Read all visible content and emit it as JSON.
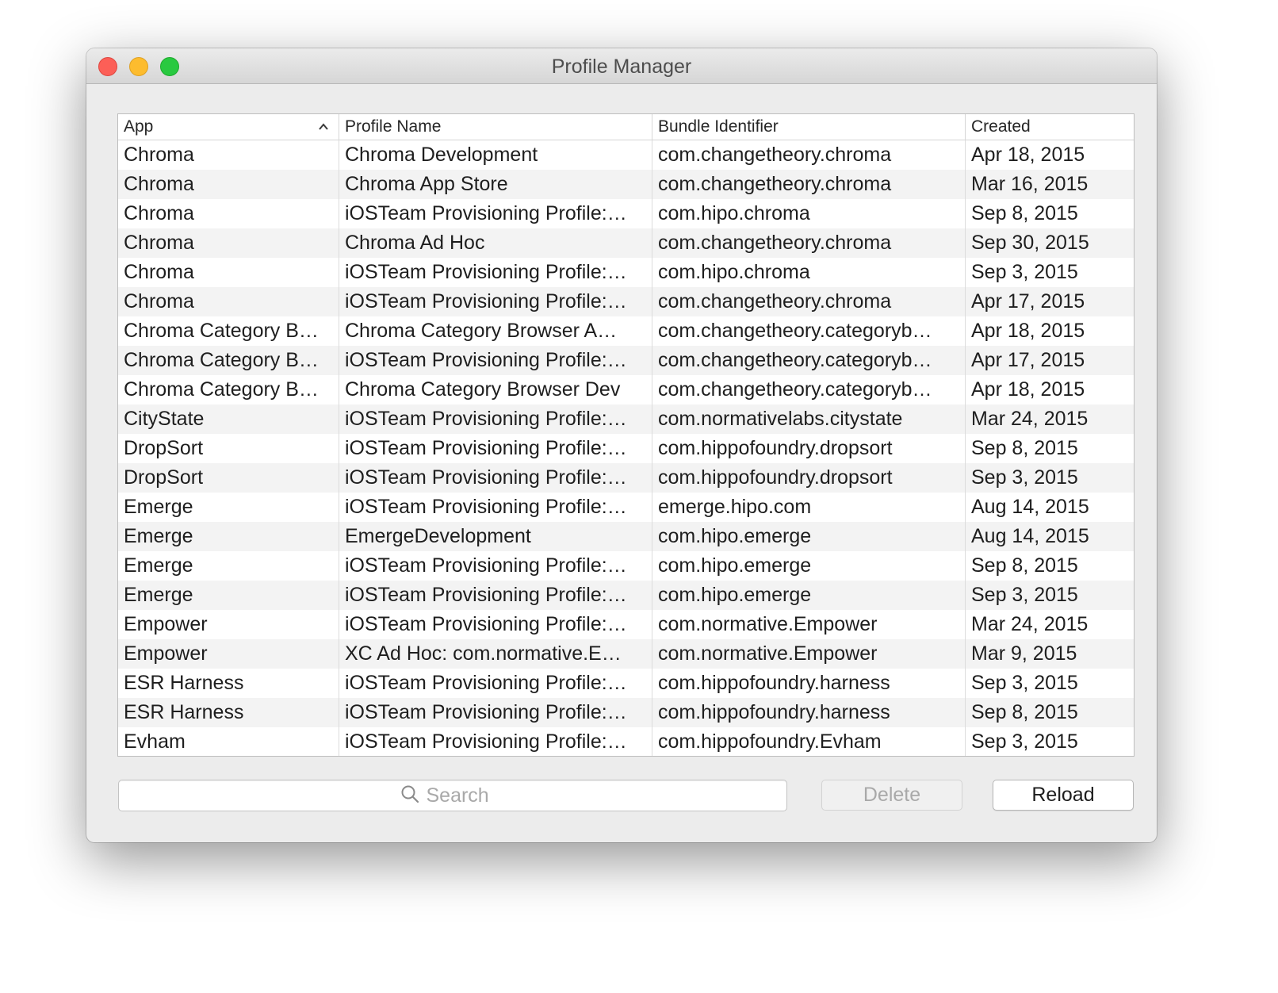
{
  "window": {
    "title": "Profile Manager"
  },
  "table": {
    "columns": {
      "app": "App",
      "profile_name": "Profile Name",
      "bundle_identifier": "Bundle Identifier",
      "created": "Created"
    },
    "sort": {
      "column": "App",
      "direction": "ascending"
    },
    "rows": [
      {
        "app": "Chroma",
        "profile": "Chroma Development",
        "bundle": "com.changetheory.chroma",
        "created": "Apr 18, 2015"
      },
      {
        "app": "Chroma",
        "profile": "Chroma App Store",
        "bundle": "com.changetheory.chroma",
        "created": "Mar 16, 2015"
      },
      {
        "app": "Chroma",
        "profile": "iOSTeam Provisioning Profile:…",
        "bundle": "com.hipo.chroma",
        "created": "Sep 8, 2015"
      },
      {
        "app": "Chroma",
        "profile": "Chroma Ad Hoc",
        "bundle": "com.changetheory.chroma",
        "created": "Sep 30, 2015"
      },
      {
        "app": "Chroma",
        "profile": "iOSTeam Provisioning Profile:…",
        "bundle": "com.hipo.chroma",
        "created": "Sep 3, 2015"
      },
      {
        "app": "Chroma",
        "profile": "iOSTeam Provisioning Profile:…",
        "bundle": "com.changetheory.chroma",
        "created": "Apr 17, 2015"
      },
      {
        "app": "Chroma Category B…",
        "profile": "Chroma Category Browser A…",
        "bundle": "com.changetheory.categoryb…",
        "created": "Apr 18, 2015"
      },
      {
        "app": "Chroma Category B…",
        "profile": "iOSTeam Provisioning Profile:…",
        "bundle": "com.changetheory.categoryb…",
        "created": "Apr 17, 2015"
      },
      {
        "app": "Chroma Category B…",
        "profile": "Chroma Category Browser Dev",
        "bundle": "com.changetheory.categoryb…",
        "created": "Apr 18, 2015"
      },
      {
        "app": "CityState",
        "profile": "iOSTeam Provisioning Profile:…",
        "bundle": "com.normativelabs.citystate",
        "created": "Mar 24, 2015"
      },
      {
        "app": "DropSort",
        "profile": "iOSTeam Provisioning Profile:…",
        "bundle": "com.hippofoundry.dropsort",
        "created": "Sep 8, 2015"
      },
      {
        "app": "DropSort",
        "profile": "iOSTeam Provisioning Profile:…",
        "bundle": "com.hippofoundry.dropsort",
        "created": "Sep 3, 2015"
      },
      {
        "app": "Emerge",
        "profile": "iOSTeam Provisioning Profile:…",
        "bundle": "emerge.hipo.com",
        "created": "Aug 14, 2015"
      },
      {
        "app": "Emerge",
        "profile": "EmergeDevelopment",
        "bundle": "com.hipo.emerge",
        "created": "Aug 14, 2015"
      },
      {
        "app": "Emerge",
        "profile": "iOSTeam Provisioning Profile:…",
        "bundle": "com.hipo.emerge",
        "created": "Sep 8, 2015"
      },
      {
        "app": "Emerge",
        "profile": "iOSTeam Provisioning Profile:…",
        "bundle": "com.hipo.emerge",
        "created": "Sep 3, 2015"
      },
      {
        "app": "Empower",
        "profile": "iOSTeam Provisioning Profile:…",
        "bundle": "com.normative.Empower",
        "created": "Mar 24, 2015"
      },
      {
        "app": "Empower",
        "profile": "XC Ad Hoc: com.normative.E…",
        "bundle": "com.normative.Empower",
        "created": "Mar 9, 2015"
      },
      {
        "app": "ESR Harness",
        "profile": "iOSTeam Provisioning Profile:…",
        "bundle": "com.hippofoundry.harness",
        "created": "Sep 3, 2015"
      },
      {
        "app": "ESR Harness",
        "profile": "iOSTeam Provisioning Profile:…",
        "bundle": "com.hippofoundry.harness",
        "created": "Sep 8, 2015"
      },
      {
        "app": "Evham",
        "profile": "iOSTeam Provisioning Profile:…",
        "bundle": "com.hippofoundry.Evham",
        "created": "Sep 3, 2015"
      }
    ]
  },
  "search": {
    "placeholder": "Search",
    "value": "",
    "icon": "magnifying-glass"
  },
  "buttons": {
    "delete_label": "Delete",
    "delete_enabled": false,
    "reload_label": "Reload"
  },
  "colors": {
    "close": "#fc5f57",
    "minimize": "#fdbc2e",
    "maximize": "#29c940",
    "row_alt": "#f3f3f3"
  }
}
